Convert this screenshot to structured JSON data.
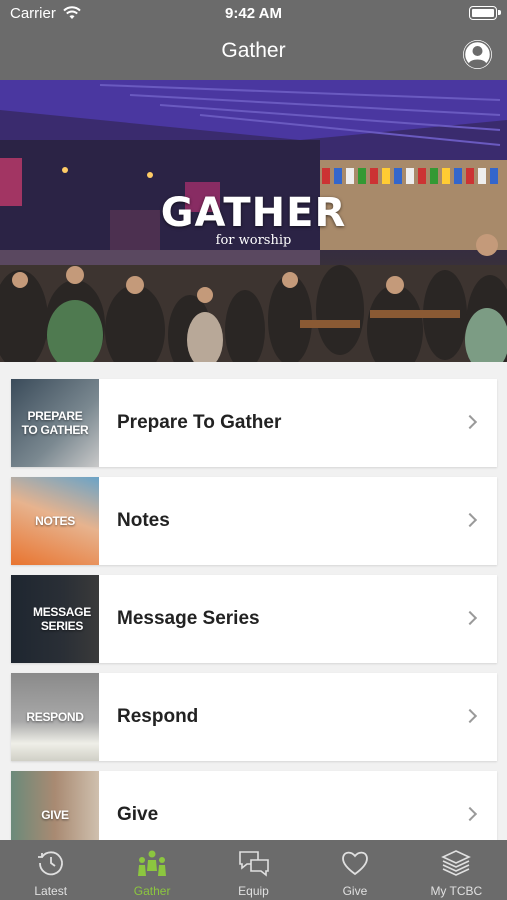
{
  "status": {
    "carrier": "Carrier",
    "time": "9:42 AM"
  },
  "nav": {
    "title": "Gather"
  },
  "hero": {
    "title": "GATHER",
    "subtitle": "for worship"
  },
  "items": [
    {
      "label": "Prepare To Gather",
      "thumb": "PREPARE\nTO GATHER"
    },
    {
      "label": "Notes",
      "thumb": "NOTES"
    },
    {
      "label": "Message Series",
      "thumb": "MESSAGE\nSERIES"
    },
    {
      "label": "Respond",
      "thumb": "RESPOND"
    },
    {
      "label": "Give",
      "thumb": "GIVE"
    }
  ],
  "tabs": [
    {
      "label": "Latest",
      "icon": "clock-icon"
    },
    {
      "label": "Gather",
      "icon": "people-icon",
      "active": true
    },
    {
      "label": "Equip",
      "icon": "chat-bubbles-icon"
    },
    {
      "label": "Give",
      "icon": "heart-icon"
    },
    {
      "label": "My TCBC",
      "icon": "layers-icon"
    }
  ],
  "colors": {
    "bar": "#6b6b6b",
    "accent": "#8cc63f"
  }
}
